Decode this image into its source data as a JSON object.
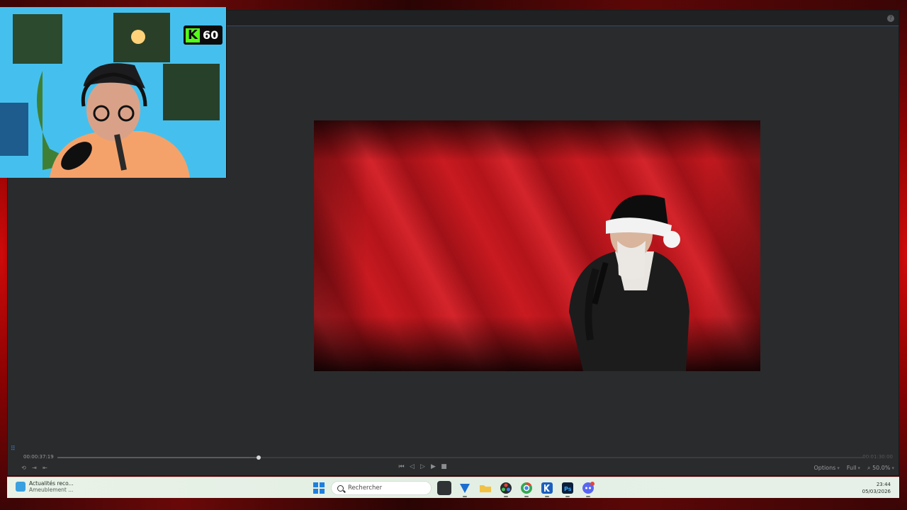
{
  "colors": {
    "accent_red": "#d00a0a",
    "editor_bg": "#2a2b2d",
    "kick_green": "#53fc18",
    "taskbar_bg": "#e6f0e6"
  },
  "webcam": {
    "platform_logo": "K",
    "viewer_count": "60"
  },
  "editor": {
    "help_label": "?",
    "playback": {
      "current_time": "00:00:37:19",
      "total_time": "00:01:30:00",
      "progress": 0.25
    },
    "controls": {
      "options_label": "Options",
      "quality_label": "Full",
      "zoom_label": "50.0%"
    },
    "icons": {
      "loop": "loop-icon",
      "export": "export-icon",
      "import": "import-icon",
      "skip_back": "skip-back-icon",
      "step_back": "step-back-icon",
      "step_forward": "step-forward-icon",
      "play": "play-icon",
      "stop": "stop-icon"
    }
  },
  "taskbar": {
    "news": {
      "title": "Actualités reco...",
      "subtitle": "Ameublement ..."
    },
    "search": {
      "placeholder": "Rechercher"
    },
    "apps": [
      "file-explorer-dark",
      "vegas-editor",
      "folder",
      "davinci",
      "chrome",
      "kick",
      "photoshop",
      "discord"
    ],
    "clock": {
      "time": "23:44",
      "date": "05/03/2026"
    }
  }
}
